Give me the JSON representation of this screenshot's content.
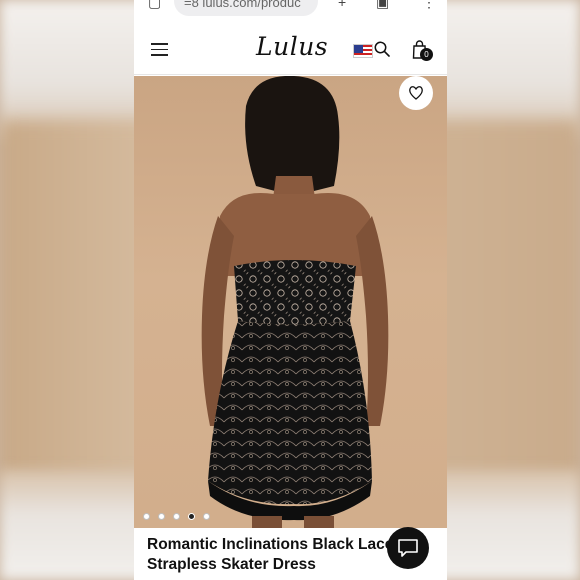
{
  "browser": {
    "url": "=8 lulus.com/produc"
  },
  "header": {
    "logo": "Lulus",
    "cart_count": "0"
  },
  "product": {
    "title": "Romantic Inclinations Black Lace Strapless Skater Dress",
    "image_count": 5,
    "active_image_index": 4
  },
  "icons": {
    "menu": "hamburger-icon",
    "flag": "us-flag-icon",
    "search": "search-icon",
    "cart": "shopping-bag-icon",
    "wishlist": "heart-icon",
    "chat": "chat-icon"
  },
  "colors": {
    "background_tan": "#d2ae8c",
    "dress_black": "#111111",
    "badge": "#111111"
  }
}
